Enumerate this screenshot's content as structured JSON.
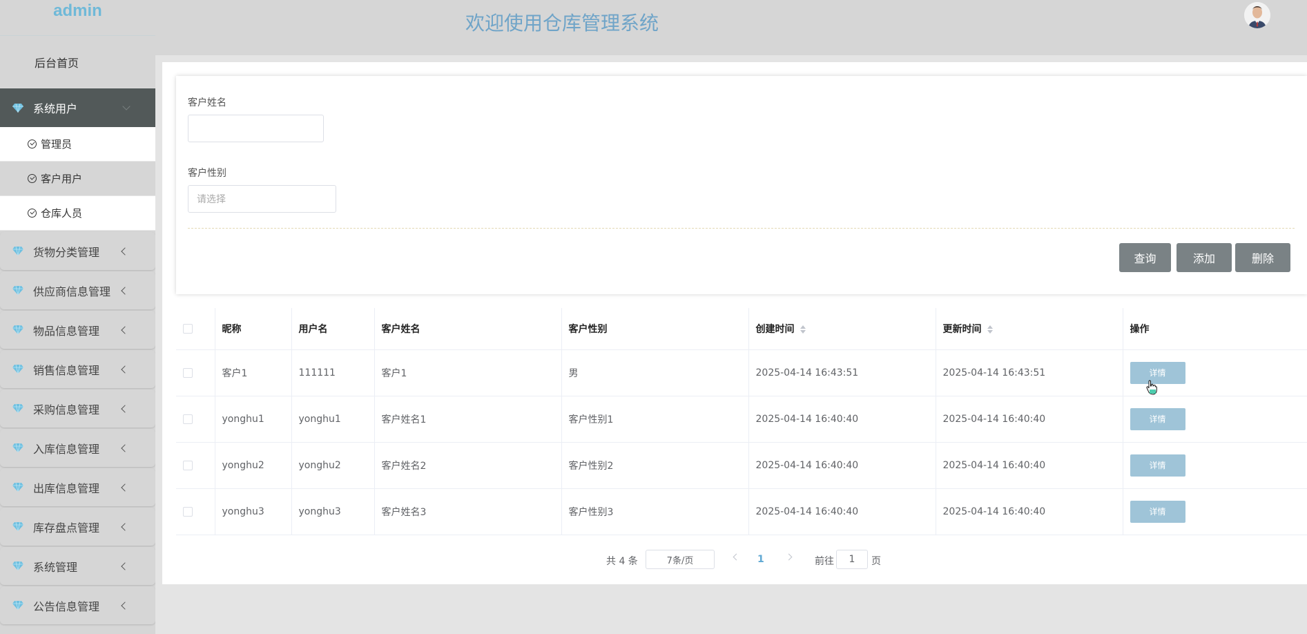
{
  "brand": "admin",
  "header": {
    "title": "欢迎使用仓库管理系统"
  },
  "sidebar": {
    "home": "后台首页",
    "active_group": "系统用户",
    "sub_items": [
      {
        "label": "管理员"
      },
      {
        "label": "客户用户"
      },
      {
        "label": "仓库人员"
      }
    ],
    "groups": [
      {
        "label": "货物分类管理"
      },
      {
        "label": "供应商信息管理"
      },
      {
        "label": "物品信息管理"
      },
      {
        "label": "销售信息管理"
      },
      {
        "label": "采购信息管理"
      },
      {
        "label": "入库信息管理"
      },
      {
        "label": "出库信息管理"
      },
      {
        "label": "库存盘点管理"
      },
      {
        "label": "系统管理"
      },
      {
        "label": "公告信息管理"
      }
    ]
  },
  "search": {
    "name_label": "客户姓名",
    "name_value": "",
    "gender_label": "客户性别",
    "gender_placeholder": "请选择",
    "query_button": "查询",
    "add_button": "添加",
    "delete_button": "删除"
  },
  "table": {
    "headers": {
      "nickname": "昵称",
      "username": "用户名",
      "name": "客户姓名",
      "gender": "客户性别",
      "created": "创建时间",
      "updated": "更新时间",
      "action": "操作"
    },
    "detail_label": "详情",
    "rows": [
      {
        "nickname": "客户1",
        "username": "111111",
        "name": "客户1",
        "gender": "男",
        "created": "2025-04-14 16:43:51",
        "updated": "2025-04-14 16:43:51"
      },
      {
        "nickname": "yonghu1",
        "username": "yonghu1",
        "name": "客户姓名1",
        "gender": "客户性别1",
        "created": "2025-04-14 16:40:40",
        "updated": "2025-04-14 16:40:40"
      },
      {
        "nickname": "yonghu2",
        "username": "yonghu2",
        "name": "客户姓名2",
        "gender": "客户性别2",
        "created": "2025-04-14 16:40:40",
        "updated": "2025-04-14 16:40:40"
      },
      {
        "nickname": "yonghu3",
        "username": "yonghu3",
        "name": "客户姓名3",
        "gender": "客户性别3",
        "created": "2025-04-14 16:40:40",
        "updated": "2025-04-14 16:40:40"
      }
    ]
  },
  "pagination": {
    "total": "共 4 条",
    "page_size": "7条/页",
    "current": "1",
    "goto_label": "前往",
    "goto_value": "1",
    "page_suffix": "页"
  }
}
